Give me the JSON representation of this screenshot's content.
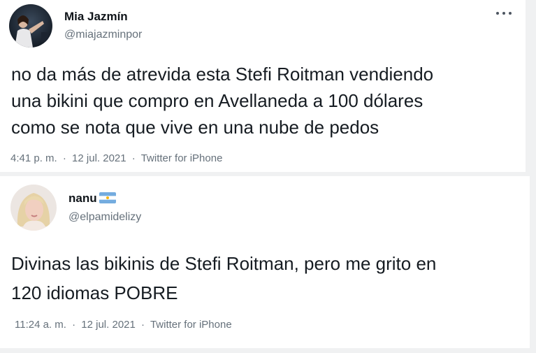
{
  "tweets": [
    {
      "name": "Mia Jazmín",
      "handle": "@miajazminpor",
      "text": "no da más de atrevida esta Stefi Roitman vendiendo\nuna bikini que compro en Avellaneda a 100 dólares\ncomo se nota que vive en una nube de pedos",
      "time": "4:41 p. m.",
      "date": "12 jul. 2021",
      "source": "Twitter for iPhone",
      "separator": "·",
      "more_icon": "more-horizontal-icon"
    },
    {
      "name": "nanu",
      "handle": "@elpamidelizy",
      "flag_icon": "argentina-flag-icon",
      "text": "Divinas las bikinis de Stefi Roitman, pero me grito en\n120 idiomas POBRE",
      "time": "11:24 a. m.",
      "date": "12 jul. 2021",
      "source": "Twitter for iPhone",
      "separator": "·"
    }
  ],
  "colors": {
    "background": "#f0f1f2",
    "card": "#ffffff",
    "text": "#161c22",
    "secondary": "#66717b",
    "flag_blue": "#74acdf",
    "flag_sun": "#f6b40e"
  }
}
